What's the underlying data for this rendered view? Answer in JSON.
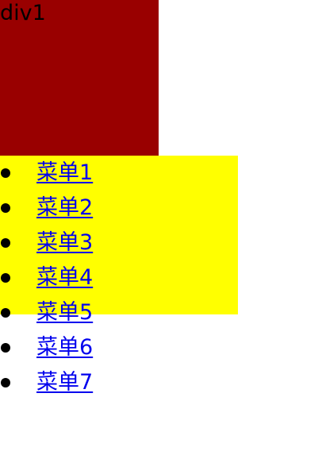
{
  "div1": {
    "label": "div1"
  },
  "menu": {
    "items": [
      {
        "label": "菜单1"
      },
      {
        "label": "菜单2"
      },
      {
        "label": "菜单3"
      },
      {
        "label": "菜单4"
      },
      {
        "label": "菜单5"
      },
      {
        "label": "菜单6"
      },
      {
        "label": "菜单7"
      }
    ]
  },
  "colors": {
    "div1_bg": "#990000",
    "highlight_bg": "#ffff00",
    "link": "#0000ee"
  }
}
